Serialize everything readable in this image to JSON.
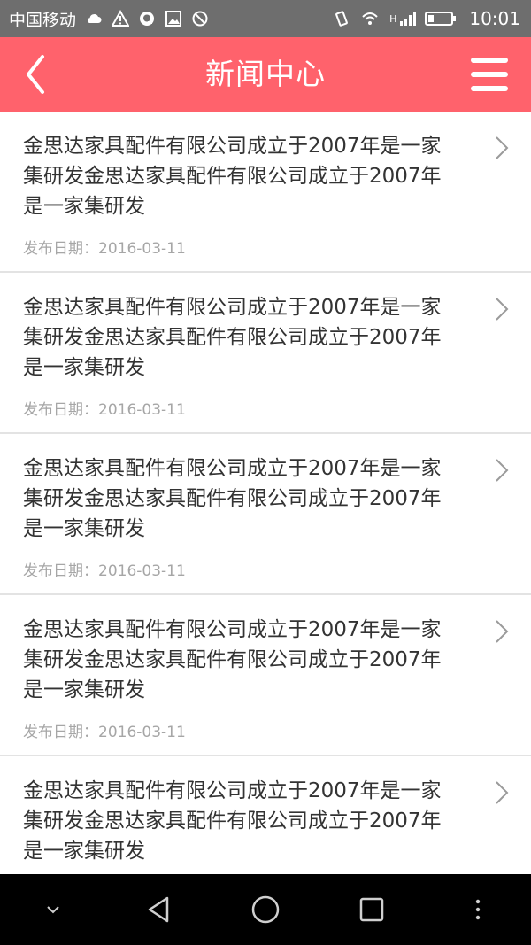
{
  "status_bar": {
    "carrier": "中国移动",
    "time": "10:01",
    "network_label": "H",
    "icons": [
      "cloud-icon",
      "warning-icon",
      "qq-icon",
      "image-icon",
      "blocked-icon",
      "vibrate-icon",
      "wifi-icon",
      "signal-icon",
      "battery-icon"
    ]
  },
  "nav": {
    "title": "新闻中心",
    "back_icon": "chevron-left-icon",
    "menu_icon": "hamburger-menu-icon",
    "background_color": "#ff626c"
  },
  "news": {
    "items": [
      {
        "title": "金思达家具配件有限公司成立于2007年是一家集研发金思达家具配件有限公司成立于2007年是一家集研发",
        "date": "发布日期：2016-03-11"
      },
      {
        "title": "金思达家具配件有限公司成立于2007年是一家集研发金思达家具配件有限公司成立于2007年是一家集研发",
        "date": "发布日期：2016-03-11"
      },
      {
        "title": "金思达家具配件有限公司成立于2007年是一家集研发金思达家具配件有限公司成立于2007年是一家集研发",
        "date": "发布日期：2016-03-11"
      },
      {
        "title": "金思达家具配件有限公司成立于2007年是一家集研发金思达家具配件有限公司成立于2007年是一家集研发",
        "date": "发布日期：2016-03-11"
      },
      {
        "title": "金思达家具配件有限公司成立于2007年是一家集研发金思达家具配件有限公司成立于2007年是一家集研发",
        "date": ""
      }
    ]
  },
  "android_nav": {
    "icons": [
      "hide-keyboard-icon",
      "back-triangle-icon",
      "home-circle-icon",
      "recents-square-icon",
      "more-dots-icon"
    ]
  }
}
